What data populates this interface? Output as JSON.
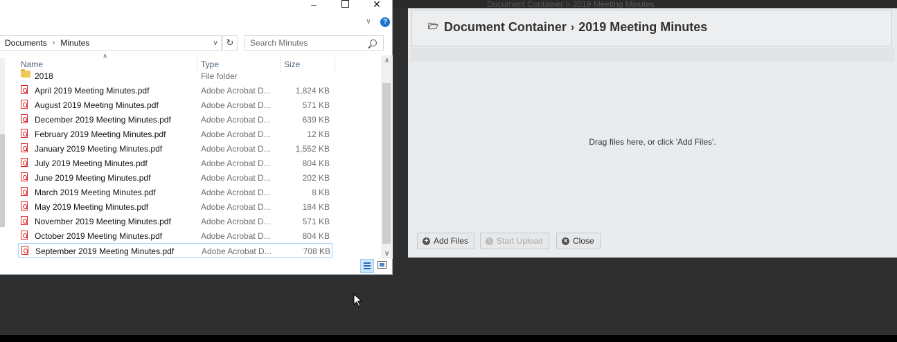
{
  "background_page": {
    "breadcrumb": "Document Container  >  2019 Meeting Minutes"
  },
  "dialog": {
    "title_parent": "Document Container",
    "title_current": "2019 Meeting Minutes",
    "drop_hint": "Drag files here, or click 'Add Files'.",
    "buttons": {
      "add_files": "Add Files",
      "start_upload": "Start Upload",
      "close": "Close"
    }
  },
  "explorer": {
    "address": {
      "crumbs": [
        "Documents",
        "Minutes"
      ]
    },
    "search": {
      "placeholder": "Search Minutes"
    },
    "columns": {
      "name": "Name",
      "type": "Type",
      "size": "Size"
    },
    "files": [
      {
        "name": "2018",
        "type": "File folder",
        "size": "",
        "kind": "folder"
      },
      {
        "name": "April 2019 Meeting Minutes.pdf",
        "type": "Adobe Acrobat D...",
        "size": "1,824 KB",
        "kind": "pdf"
      },
      {
        "name": "August 2019 Meeting Minutes.pdf",
        "type": "Adobe Acrobat D...",
        "size": "571 KB",
        "kind": "pdf"
      },
      {
        "name": "December 2019 Meeting Minutes.pdf",
        "type": "Adobe Acrobat D...",
        "size": "639 KB",
        "kind": "pdf"
      },
      {
        "name": "February 2019 Meeting Minutes.pdf",
        "type": "Adobe Acrobat D...",
        "size": "12 KB",
        "kind": "pdf"
      },
      {
        "name": "January 2019 Meeting Minutes.pdf",
        "type": "Adobe Acrobat D...",
        "size": "1,552 KB",
        "kind": "pdf"
      },
      {
        "name": "July 2019 Meeting Minutes.pdf",
        "type": "Adobe Acrobat D...",
        "size": "804 KB",
        "kind": "pdf"
      },
      {
        "name": "June 2019 Meeting Minutes.pdf",
        "type": "Adobe Acrobat D...",
        "size": "202 KB",
        "kind": "pdf"
      },
      {
        "name": "March 2019 Meeting Minutes.pdf",
        "type": "Adobe Acrobat D...",
        "size": "8 KB",
        "kind": "pdf"
      },
      {
        "name": "May 2019 Meeting Minutes.pdf",
        "type": "Adobe Acrobat D...",
        "size": "184 KB",
        "kind": "pdf"
      },
      {
        "name": "November 2019 Meeting Minutes.pdf",
        "type": "Adobe Acrobat D...",
        "size": "571 KB",
        "kind": "pdf"
      },
      {
        "name": "October 2019 Meeting Minutes.pdf",
        "type": "Adobe Acrobat D...",
        "size": "804 KB",
        "kind": "pdf"
      },
      {
        "name": "September 2019 Meeting Minutes.pdf",
        "type": "Adobe Acrobat D...",
        "size": "708 KB",
        "kind": "pdf",
        "selected": true
      }
    ]
  },
  "colors": {
    "desktop": "#2f2f2f",
    "dialog_bg": "#e9ecee",
    "selection_border": "#99d1ff",
    "help_blue": "#1e73d2",
    "pdf_red": "#d22222"
  }
}
